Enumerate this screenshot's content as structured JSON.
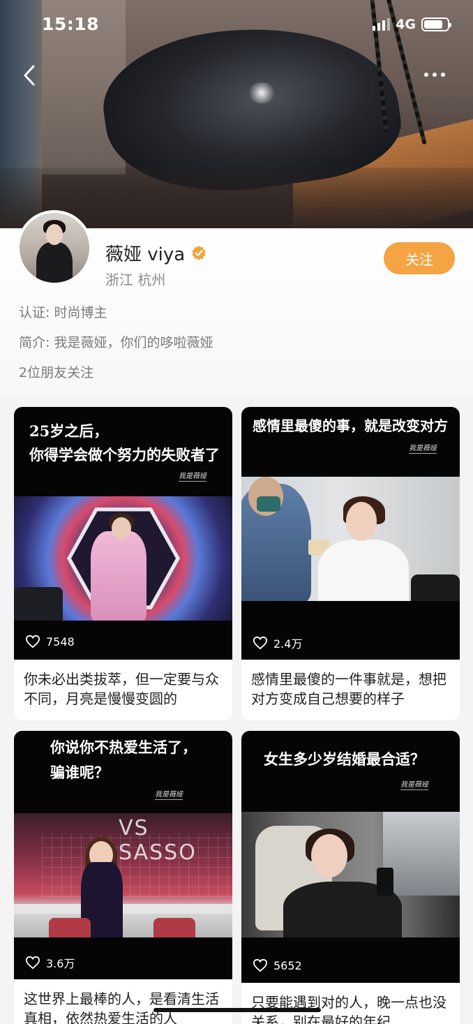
{
  "status_bar": {
    "time": "15:18",
    "network": "4G"
  },
  "header": {
    "back_icon": "chevron-left-icon",
    "more_icon": "more-dots-icon"
  },
  "profile": {
    "name": "薇娅 viya",
    "location": "浙江 杭州",
    "follow_label": "关注",
    "verification": "认证: 时尚博主",
    "bio": "简介: 我是薇娅，你们的哆啦薇娅",
    "friends_following": "2位朋友关注",
    "accent_color": "#f5a443"
  },
  "posts": [
    {
      "headline_line1": "25岁之后，",
      "headline_line2": "你得学会做个努力的失败者了",
      "signature": "我是薇娅",
      "likes": "7548",
      "caption": "你未必出类拔萃，但一定要与众不同，月亮是慢慢变圆的"
    },
    {
      "headline_line1": "感情里最傻的事，就是改变对方",
      "signature": "我是薇娅",
      "likes": "2.4万",
      "caption": "感情里最傻的一件事就是，想把对方变成自己想要的样子"
    },
    {
      "headline_line1": "你说你不热爱生活了，",
      "headline_line2": "骗谁呢？",
      "signature": "我是薇娅",
      "likes": "3.6万",
      "neon_text": "VS SASSO",
      "caption": "这世界上最棒的人，是看清生活真相，依然热爱生活的人"
    },
    {
      "headline_line1": "女生多少岁结婚最合适？",
      "signature": "我是薇娅",
      "likes": "5652",
      "caption": "只要能遇到对的人，晚一点也没关系，别在最好的年纪"
    }
  ]
}
